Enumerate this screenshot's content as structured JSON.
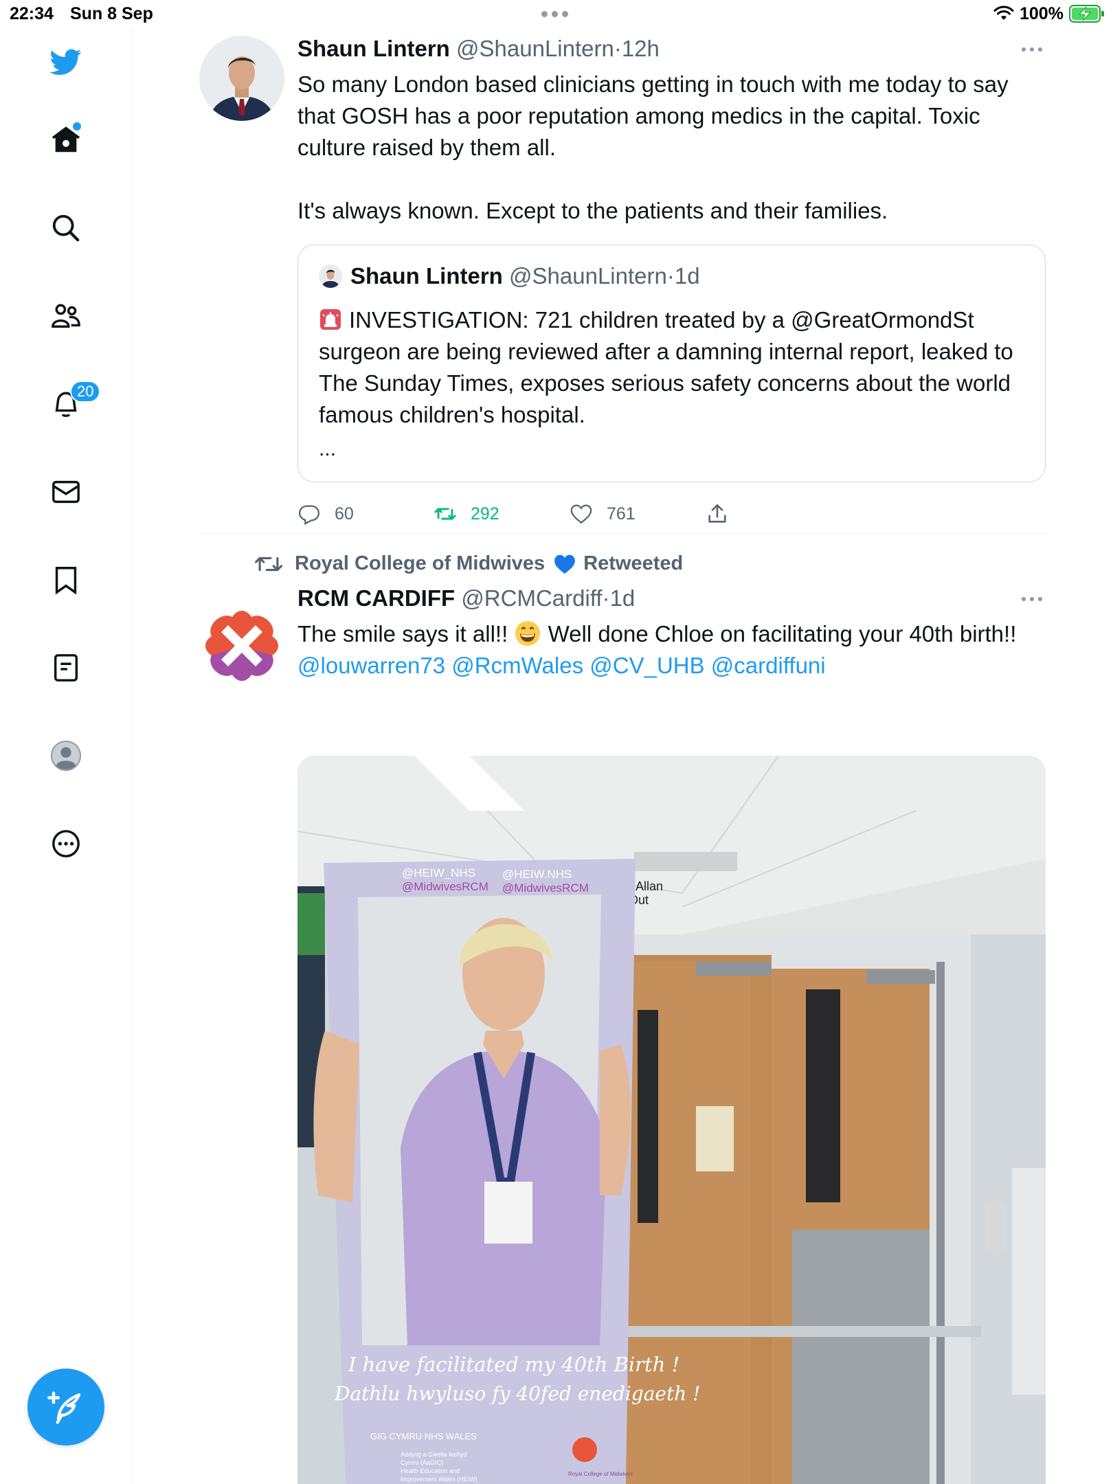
{
  "status_bar": {
    "time": "22:34",
    "date": "Sun 8 Sep",
    "battery": "100%"
  },
  "sidebar": {
    "items": [
      {
        "icon": "twitter-logo-icon"
      },
      {
        "icon": "home-icon",
        "unread_dot": true
      },
      {
        "icon": "search-icon"
      },
      {
        "icon": "communities-icon"
      },
      {
        "icon": "notifications-icon",
        "badge": "20"
      },
      {
        "icon": "messages-icon"
      },
      {
        "icon": "bookmarks-icon"
      },
      {
        "icon": "lists-icon"
      },
      {
        "icon": "profile-icon"
      },
      {
        "icon": "more-options-icon"
      }
    ],
    "compose_icon": "compose-tweet-icon"
  },
  "colors": {
    "accent": "#1d9bf0",
    "secondary_text": "#536471",
    "retweet_green": "#00ba7c"
  },
  "tweet1": {
    "name": "Shaun Lintern",
    "handle": "@ShaunLintern",
    "sep": "·",
    "time": "12h",
    "text": "So many London based clinicians getting in touch with me today to say that GOSH has a poor reputation among medics in the capital. Toxic culture raised by them all.\n\nIt's always known. Except to the patients and their families.",
    "quote": {
      "name": "Shaun Lintern",
      "handle": "@ShaunLintern",
      "sep": "·",
      "time": "1d",
      "text": "INVESTIGATION: 721 children treated by a @GreatOrmondSt surgeon are being reviewed after a damning internal report, leaked to The Sunday Times, exposes serious safety concerns about the world famous children's hospital.",
      "ellipsis": "..."
    },
    "replies": "60",
    "retweets": "292",
    "likes": "761"
  },
  "tweet2": {
    "retweeted_by": "Royal College of Midwives",
    "retweeted_label": "Retweeted",
    "name": "RCM CARDIFF",
    "handle": "@RCMCardiff",
    "sep": "·",
    "time": "1d",
    "text_part1": "The smile says it all!! ",
    "text_part2": " Well done Chloe on facilitating your 40th birth!! ",
    "mentions": [
      "@louwarren73",
      "@RcmWales",
      "@CV_UHB",
      "@cardiffuni"
    ],
    "photo": {
      "frame_top_left": "@HEIW_NHS",
      "frame_top_left2": "@MidwivesRCM",
      "frame_top_right": "@HEIW.NHS",
      "frame_top_right2": "@MidwivesRCM",
      "caption_line1": "I have facilitated my 40th Birth !",
      "caption_line2": "Dathlu hwyluso fy 40fed enedigaeth !",
      "logo_text_left": "GIG CYMRU NHS WALES",
      "logo_text_mid1": "Addysg a Gwella Iechyd",
      "logo_text_mid2": "Cymru (AaGIC)",
      "logo_text_mid3": "Health Education and",
      "logo_text_mid4": "Improvement Wales (HEIW)",
      "logo_text_right": "Royal College of Midwives",
      "sign1": "l Allan",
      "sign2": "Out"
    }
  }
}
